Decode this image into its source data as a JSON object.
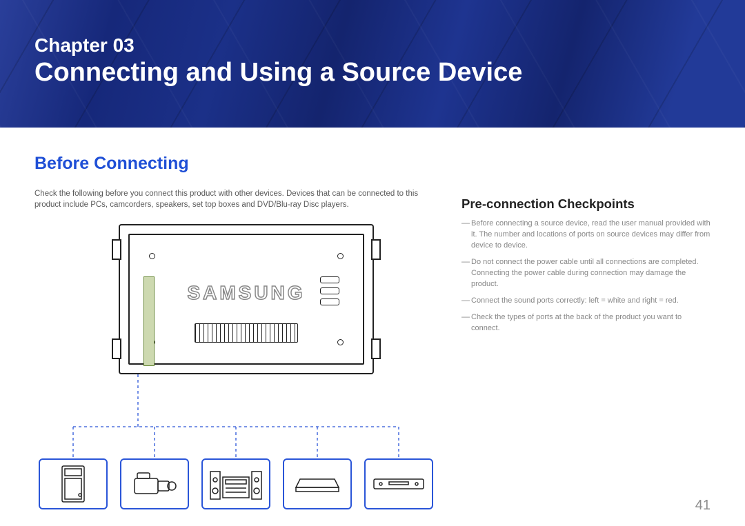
{
  "banner": {
    "chapter_label": "Chapter 03",
    "chapter_title": "Connecting and Using a Source Device"
  },
  "section": {
    "heading": "Before Connecting",
    "intro": "Check the following before you connect this product with other devices. Devices that can be connected to this product include PCs, camcorders, speakers, set top boxes and DVD/Blu-ray Disc players."
  },
  "checkpoints": {
    "heading": "Pre-connection Checkpoints",
    "items": [
      "Before connecting a source device, read the user manual provided with it. The number and locations of ports on source devices may differ from device to device.",
      "Do not connect the power cable until all connections are completed. Connecting the power cable during connection may damage the product.",
      "Connect the sound ports correctly: left = white and right = red.",
      "Check the types of ports at the back of the product you want to connect."
    ]
  },
  "diagram": {
    "brand_text": "SAMSUNG",
    "devices": [
      "pc-tower",
      "camcorder",
      "speaker-system",
      "set-top-box",
      "disc-player"
    ]
  },
  "page_number": "41"
}
